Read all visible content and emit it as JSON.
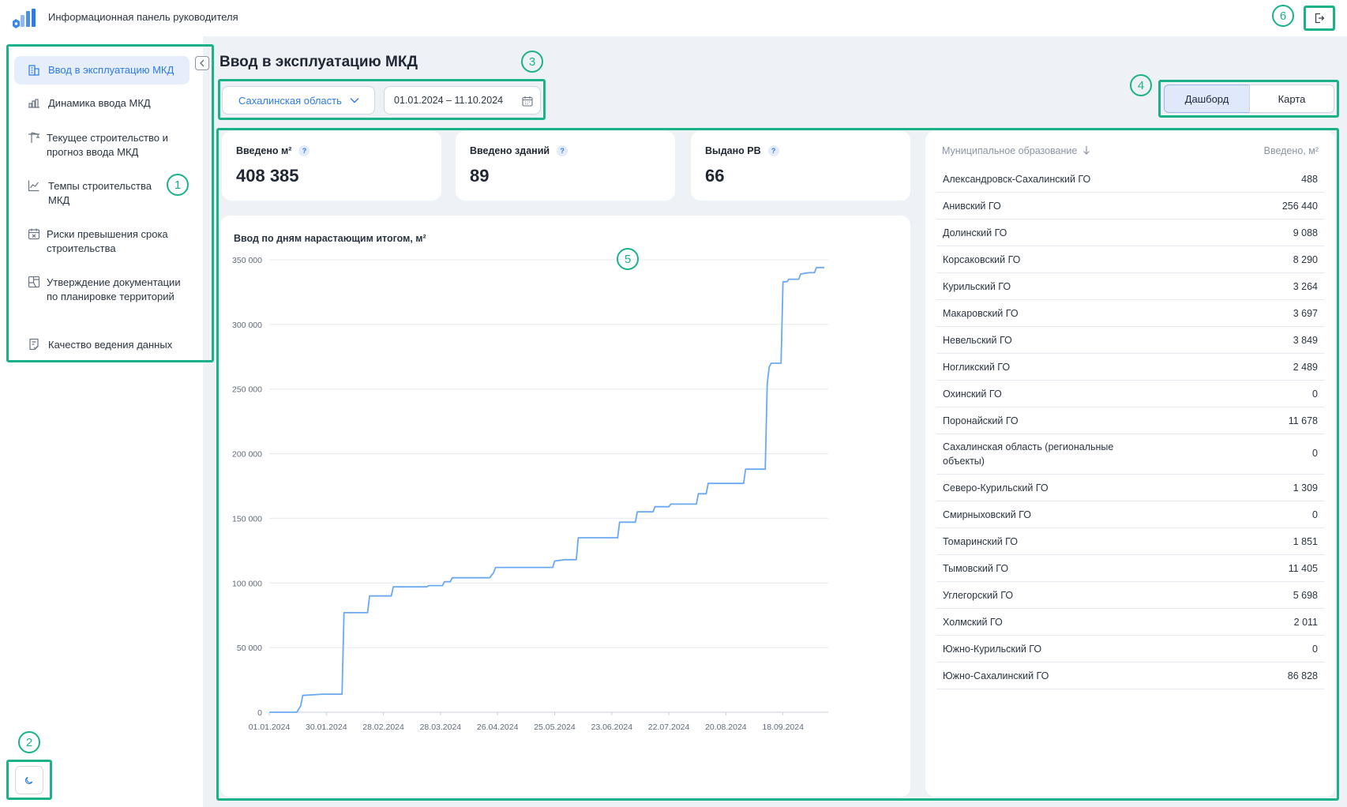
{
  "app": {
    "title": "Информационная панель руководителя"
  },
  "sidebar": {
    "items": [
      {
        "label": "Ввод в эксплуатацию МКД",
        "icon": "building-icon",
        "active": true
      },
      {
        "label": "Динамика ввода МКД",
        "icon": "bar-chart-building-icon"
      },
      {
        "label": "Текущее строительство и прогноз ввода МКД",
        "icon": "crane-icon"
      },
      {
        "label": "Темпы строительства МКД",
        "icon": "line-chart-icon"
      },
      {
        "label": "Риски превышения срока строительства",
        "icon": "calendar-x-icon"
      },
      {
        "label": "Утверждение документации по планировке территорий",
        "icon": "map-plan-icon"
      },
      {
        "label": "Качество ведения данных",
        "icon": "checklist-icon"
      }
    ]
  },
  "page": {
    "title": "Ввод в эксплуатацию МКД"
  },
  "filters": {
    "region": "Сахалинская область",
    "date_range": "01.01.2024 – 11.10.2024"
  },
  "view_tabs": {
    "dashboard": "Дашборд",
    "map": "Карта",
    "active": "dashboard"
  },
  "kpis": [
    {
      "label": "Введено м²",
      "value": "408 385"
    },
    {
      "label": "Введено зданий",
      "value": "89"
    },
    {
      "label": "Выдано РВ",
      "value": "66"
    }
  ],
  "help_glyph": "?",
  "badges": [
    "1",
    "2",
    "3",
    "4",
    "5",
    "6"
  ],
  "chart_data": {
    "type": "line",
    "title": "Ввод по дням нарастающим итогом, м²",
    "xlabel": "",
    "ylabel": "",
    "x_axis_type": "date",
    "x_range": [
      "2024-01-01",
      "2024-10-11"
    ],
    "ylim": [
      0,
      350000
    ],
    "y_ticks": [
      "0",
      "50 000",
      "100 000",
      "150 000",
      "200 000",
      "250 000",
      "300 000",
      "350 000"
    ],
    "x_ticks": [
      {
        "date": "2024-01-01",
        "label": "01.01.2024"
      },
      {
        "date": "2024-01-30",
        "label": "30.01.2024"
      },
      {
        "date": "2024-02-28",
        "label": "28.02.2024"
      },
      {
        "date": "2024-03-28",
        "label": "28.03.2024"
      },
      {
        "date": "2024-04-26",
        "label": "26.04.2024"
      },
      {
        "date": "2024-05-25",
        "label": "25.05.2024"
      },
      {
        "date": "2024-06-23",
        "label": "23.06.2024"
      },
      {
        "date": "2024-07-22",
        "label": "22.07.2024"
      },
      {
        "date": "2024-08-20",
        "label": "20.08.2024"
      },
      {
        "date": "2024-09-18",
        "label": "18.09.2024"
      }
    ],
    "grid": true,
    "color": "#6aa9f2",
    "series": [
      {
        "values": [
          [
            "2024-01-01",
            0
          ],
          [
            "2024-01-15",
            0
          ],
          [
            "2024-01-17",
            5000
          ],
          [
            "2024-01-18",
            13000
          ],
          [
            "2024-01-28",
            14000
          ],
          [
            "2024-02-07",
            14000
          ],
          [
            "2024-02-08",
            77000
          ],
          [
            "2024-02-20",
            77000
          ],
          [
            "2024-02-21",
            90000
          ],
          [
            "2024-03-03",
            90000
          ],
          [
            "2024-03-04",
            97000
          ],
          [
            "2024-03-21",
            97000
          ],
          [
            "2024-03-22",
            98000
          ],
          [
            "2024-03-29",
            98000
          ],
          [
            "2024-03-30",
            101000
          ],
          [
            "2024-04-02",
            101000
          ],
          [
            "2024-04-03",
            104000
          ],
          [
            "2024-04-22",
            104000
          ],
          [
            "2024-04-24",
            108000
          ],
          [
            "2024-04-25",
            112000
          ],
          [
            "2024-05-24",
            112000
          ],
          [
            "2024-05-25",
            117000
          ],
          [
            "2024-05-30",
            118000
          ],
          [
            "2024-06-05",
            118000
          ],
          [
            "2024-06-06",
            135000
          ],
          [
            "2024-06-26",
            135000
          ],
          [
            "2024-06-27",
            147000
          ],
          [
            "2024-07-05",
            147000
          ],
          [
            "2024-07-06",
            155000
          ],
          [
            "2024-07-14",
            155000
          ],
          [
            "2024-07-15",
            159000
          ],
          [
            "2024-07-22",
            159000
          ],
          [
            "2024-07-23",
            161000
          ],
          [
            "2024-08-05",
            161000
          ],
          [
            "2024-08-06",
            169000
          ],
          [
            "2024-08-10",
            169000
          ],
          [
            "2024-08-11",
            177000
          ],
          [
            "2024-08-29",
            177000
          ],
          [
            "2024-08-30",
            188000
          ],
          [
            "2024-09-09",
            188000
          ],
          [
            "2024-09-10",
            254000
          ],
          [
            "2024-09-11",
            267000
          ],
          [
            "2024-09-12",
            270000
          ],
          [
            "2024-09-17",
            270000
          ],
          [
            "2024-09-18",
            333000
          ],
          [
            "2024-09-20",
            333000
          ],
          [
            "2024-09-21",
            335000
          ],
          [
            "2024-09-26",
            335000
          ],
          [
            "2024-09-27",
            339000
          ],
          [
            "2024-10-01",
            340000
          ],
          [
            "2024-10-04",
            340000
          ],
          [
            "2024-10-05",
            344000
          ],
          [
            "2024-10-09",
            344000
          ]
        ]
      }
    ]
  },
  "table": {
    "col_name": "Муниципальное образование",
    "col_value": "Введено, м²",
    "rows": [
      {
        "name": "Александровск-Сахалинский ГО",
        "value": "488"
      },
      {
        "name": "Анивский ГО",
        "value": "256 440"
      },
      {
        "name": "Долинский ГО",
        "value": "9 088"
      },
      {
        "name": "Корсаковский ГО",
        "value": "8 290"
      },
      {
        "name": "Курильский ГО",
        "value": "3 264"
      },
      {
        "name": "Макаровский ГО",
        "value": "3 697"
      },
      {
        "name": "Невельский ГО",
        "value": "3 849"
      },
      {
        "name": "Ногликский ГО",
        "value": "2 489"
      },
      {
        "name": "Охинский ГО",
        "value": "0"
      },
      {
        "name": "Поронайский ГО",
        "value": "11 678"
      },
      {
        "name": "Сахалинская область (региональные объекты)",
        "value": "0"
      },
      {
        "name": "Северо-Курильский ГО",
        "value": "1 309"
      },
      {
        "name": "Смирныховский ГО",
        "value": "0"
      },
      {
        "name": "Томаринский ГО",
        "value": "1 851"
      },
      {
        "name": "Тымовский ГО",
        "value": "11 405"
      },
      {
        "name": "Углегорский ГО",
        "value": "5 698"
      },
      {
        "name": "Холмский ГО",
        "value": "2 011"
      },
      {
        "name": "Южно-Курильский ГО",
        "value": "0"
      },
      {
        "name": "Южно-Сахалинский ГО",
        "value": "86 828"
      }
    ]
  }
}
